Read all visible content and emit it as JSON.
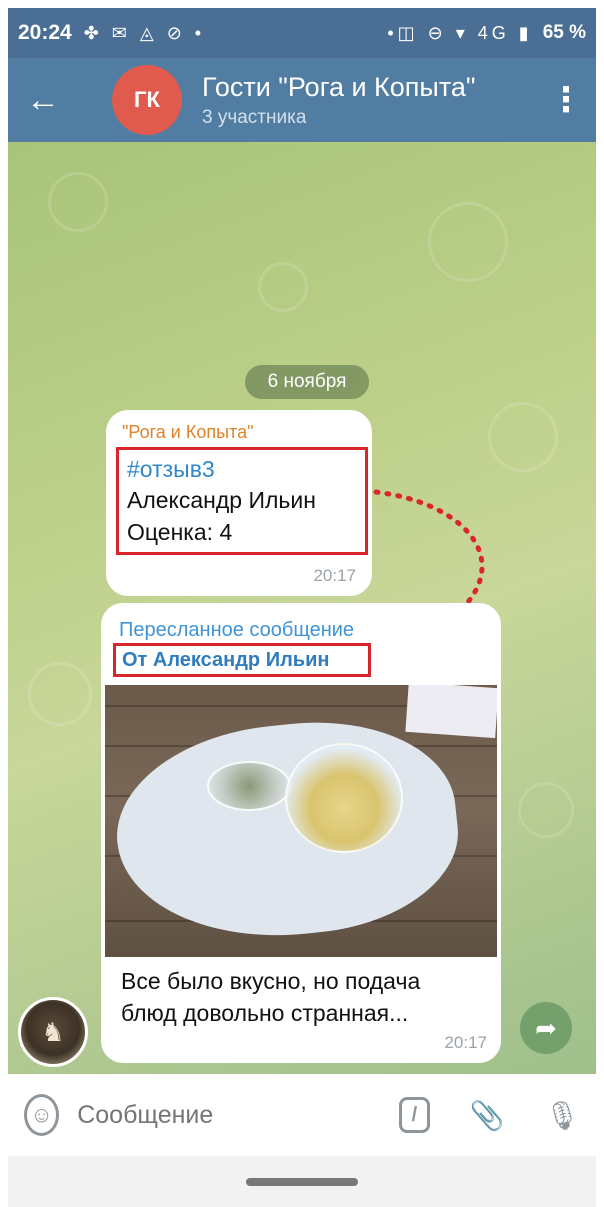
{
  "status_bar": {
    "time": "20:24",
    "left_icons": "✤ ✉ ◬ ⊘ •",
    "right_icons": "•◫ ⊖ ▾ 4G ▮",
    "battery": "65 %"
  },
  "header": {
    "back_icon": "←",
    "avatar_initials": "ГК",
    "title": "Гости \"Рога и Копыта\"",
    "subtitle": "3 участника",
    "menu_icon": "⋮"
  },
  "chat": {
    "date_chip": "6 ноября",
    "message1": {
      "sender": "\"Рога и Копыта\"",
      "hashtag": "#отзыв3",
      "line1": "Александр Ильин",
      "line2": "Оценка: 4",
      "time": "20:17"
    },
    "message2": {
      "forwarded_label": "Пересланное сообщение",
      "forwarded_from": "От Александр Ильин",
      "text_line1": "Все было вкусно, но подача",
      "text_line2": "блюд довольно странная...",
      "time": "20:17"
    },
    "share_icon": "➦"
  },
  "input_bar": {
    "emoji_icon": "☺",
    "placeholder": "Сообщение",
    "command_icon": "/",
    "attach_icon": "📎",
    "mic_icon": "🎙"
  },
  "colors": {
    "header": "#517da2",
    "status_bar": "#4b6f94",
    "avatar": "#e05a4d",
    "highlight_box": "#d9262c",
    "link": "#2f86c8",
    "sender": "#e0822a"
  }
}
